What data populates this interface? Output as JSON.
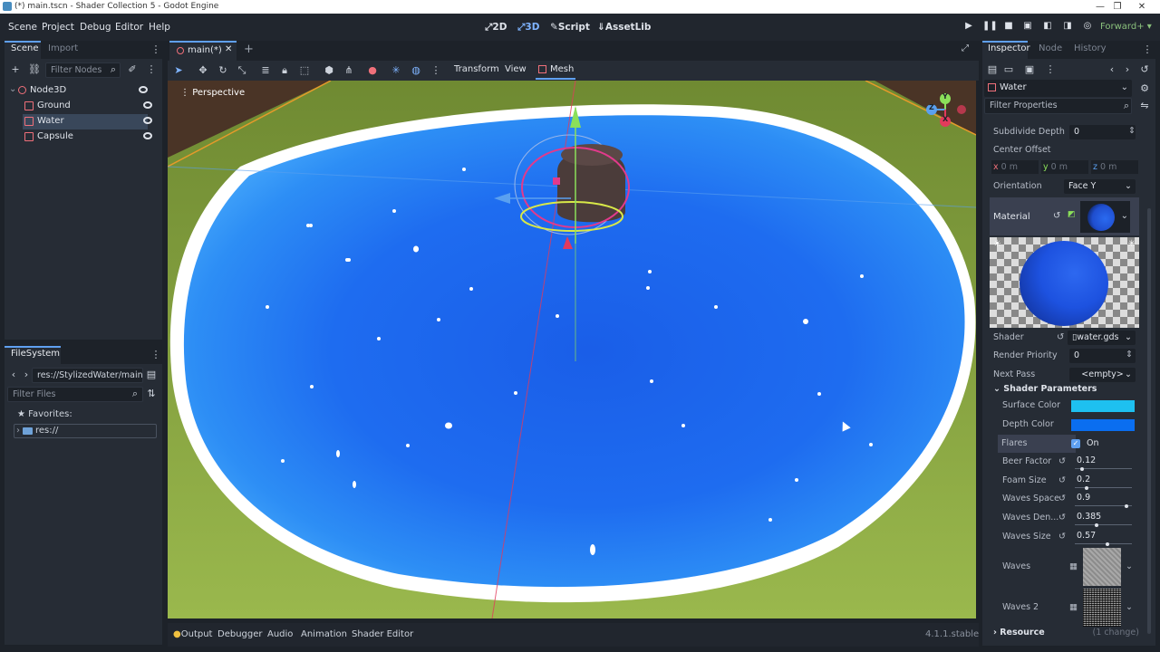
{
  "window": {
    "title": "(*) main.tscn - Shader Collection 5 - Godot Engine"
  },
  "menu": [
    "Scene",
    "Project",
    "Debug",
    "Editor",
    "Help"
  ],
  "workspaces": [
    {
      "label": "2D",
      "icon": "2d-icon"
    },
    {
      "label": "3D",
      "icon": "3d-icon",
      "active": true
    },
    {
      "label": "Script",
      "icon": "script-icon"
    },
    {
      "label": "AssetLib",
      "icon": "assetlib-icon"
    }
  ],
  "renderer": "Forward+",
  "scene_dock": {
    "tabs": [
      "Scene",
      "Import"
    ],
    "filter_placeholder": "Filter Nodes",
    "nodes": [
      {
        "name": "Node3D",
        "depth": 0
      },
      {
        "name": "Ground",
        "depth": 1
      },
      {
        "name": "Water",
        "depth": 1,
        "selected": true
      },
      {
        "name": "Capsule",
        "depth": 1
      }
    ]
  },
  "filesystem": {
    "title": "FileSystem",
    "path": "res://StylizedWater/main.t",
    "filter_placeholder": "Filter Files",
    "favorites_label": "Favorites:",
    "root": "res://"
  },
  "editor": {
    "scene_tab": "main(*)",
    "toolbar_menus": [
      "Transform",
      "View"
    ],
    "mesh_menu": "Mesh",
    "viewport_label": "Perspective",
    "gizmo": {
      "x": "X",
      "y": "Y",
      "z": "Z"
    }
  },
  "bottom_tabs": [
    "Output",
    "Debugger",
    "Audio",
    "Animation",
    "Shader Editor"
  ],
  "version": "4.1.1.stable",
  "inspector": {
    "tabs": [
      "Inspector",
      "Node",
      "History"
    ],
    "object": "Water",
    "filter_placeholder": "Filter Properties",
    "subdivide_depth": {
      "label": "Subdivide Depth",
      "value": "0"
    },
    "center_offset": {
      "label": "Center Offset",
      "x": "0 m",
      "y": "0 m",
      "z": "0 m",
      "xl": "x",
      "yl": "y",
      "zl": "z"
    },
    "orientation": {
      "label": "Orientation",
      "value": "Face Y"
    },
    "material_label": "Material",
    "shader": {
      "label": "Shader",
      "value": "water.gds"
    },
    "render_priority": {
      "label": "Render Priority",
      "value": "0"
    },
    "next_pass": {
      "label": "Next Pass",
      "value": "<empty>"
    },
    "shader_params_header": "Shader Parameters",
    "surface_color": {
      "label": "Surface Color",
      "color": "#1ec0f0"
    },
    "depth_color": {
      "label": "Depth Color",
      "color": "#0a6ef0"
    },
    "flares": {
      "label": "Flares",
      "value": "On"
    },
    "params": [
      {
        "label": "Beer Factor",
        "value": "0.12",
        "frac": 0.12
      },
      {
        "label": "Foam Size",
        "value": "0.2",
        "frac": 0.2
      },
      {
        "label": "Waves Space",
        "value": "0.9",
        "frac": 0.9
      },
      {
        "label": "Waves Den...",
        "value": "0.385",
        "frac": 0.385
      },
      {
        "label": "Waves Size",
        "value": "0.57",
        "frac": 0.57
      }
    ],
    "waves": {
      "label": "Waves"
    },
    "waves2": {
      "label": "Waves 2"
    },
    "resource": {
      "label": "Resource",
      "note": "(1 change)"
    }
  }
}
